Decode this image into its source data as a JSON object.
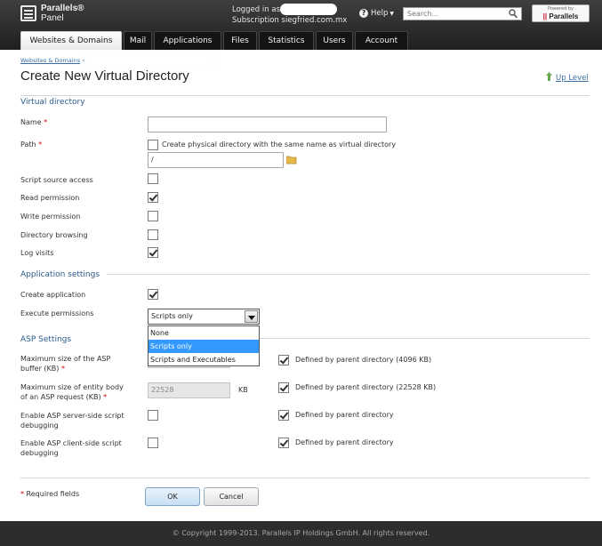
{
  "header": {
    "brand_line1": "Parallels®",
    "brand_line2": "Panel",
    "logged_in_label": "Logged in as",
    "subscription_label": "Subscription",
    "subscription_value": "siegfried.com.mx",
    "help_label": "Help",
    "search_placeholder": "Search...",
    "powered_small": "Powered by",
    "powered_brand": "Parallels"
  },
  "tabs": [
    {
      "label": "Websites & Domains",
      "active": true
    },
    {
      "label": "Mail"
    },
    {
      "label": "Applications"
    },
    {
      "label": "Files"
    },
    {
      "label": "Statistics"
    },
    {
      "label": "Users"
    },
    {
      "label": "Account"
    }
  ],
  "breadcrumb": {
    "item": "Websites & Domains",
    "sep": "»"
  },
  "page_title": "Create New Virtual Directory",
  "up_level": "Up Level",
  "virtual_directory": {
    "title": "Virtual directory",
    "name_label": "Name",
    "name_value": "",
    "path_label": "Path",
    "create_physical_label": "Create physical directory with the same name as virtual directory",
    "create_physical_checked": false,
    "path_value": "/",
    "script_source_label": "Script source access",
    "script_source_checked": false,
    "read_label": "Read permission",
    "read_checked": true,
    "write_label": "Write permission",
    "write_checked": false,
    "browsing_label": "Directory browsing",
    "browsing_checked": false,
    "log_label": "Log visits",
    "log_checked": true
  },
  "application_settings": {
    "title": "Application settings",
    "create_app_label": "Create application",
    "create_app_checked": true,
    "execute_label": "Execute permissions",
    "execute_value": "Scripts only",
    "execute_options": [
      "None",
      "Scripts only",
      "Scripts and Executables"
    ]
  },
  "asp_settings": {
    "title": "ASP Settings",
    "buffer_label_1": "Maximum size of the ASP",
    "buffer_label_2": "buffer (KB)",
    "buffer_parent_label": "Defined by parent directory (4096 KB)",
    "buffer_parent_checked": true,
    "entity_label_1": "Maximum size of entity body",
    "entity_label_2": "of an ASP request (KB)",
    "entity_value": "22528",
    "entity_unit": "KB",
    "entity_parent_label": "Defined by parent directory (22528 KB)",
    "entity_parent_checked": true,
    "server_debug_label_1": "Enable ASP server-side script",
    "server_debug_label_2": "debugging",
    "server_debug_checked": false,
    "server_parent_label": "Defined by parent directory",
    "server_parent_checked": true,
    "client_debug_label_1": "Enable ASP client-side script",
    "client_debug_label_2": "debugging",
    "client_debug_checked": false,
    "client_parent_label": "Defined by parent directory",
    "client_parent_checked": true
  },
  "required_note": "Required fields",
  "required_star": "*",
  "buttons": {
    "ok": "OK",
    "cancel": "Cancel"
  },
  "footer": "© Copyright 1999-2013. Parallels IP Holdings GmbH. All rights reserved.",
  "colors": {
    "section": "#2a5a8c",
    "link": "#3a6ea5",
    "selection": "#3399ff",
    "header_bg": "#2a2a2a"
  }
}
